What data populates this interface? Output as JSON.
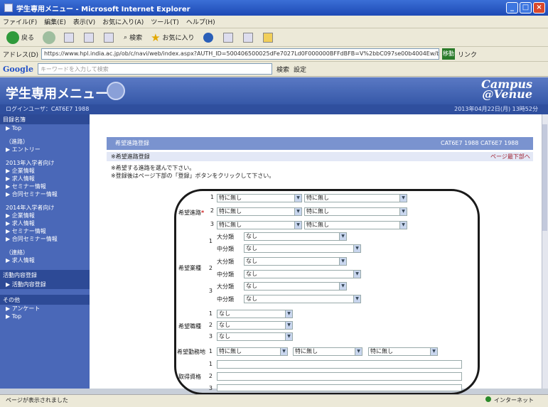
{
  "window": {
    "title": "学生専用メニュー - Microsoft Internet Explorer"
  },
  "menu": [
    "ファイル(F)",
    "編集(E)",
    "表示(V)",
    "お気に入り(A)",
    "ツール(T)",
    "ヘルプ(H)"
  ],
  "toolbar": {
    "back": "戻る",
    "search": "検索",
    "favorites": "お気に入り"
  },
  "address": {
    "label": "アドレス(D)",
    "url": "https://www.hpl.india.ac.jp/ob/c/navi/web/index.aspx?AUTH_ID=500406500025dFe7027Ld0F000000BFFdBFB=V%2bbC097se00b4004Ew/b4ad=W9Rar=3",
    "go": "移動",
    "links": "リンク"
  },
  "google": {
    "brand": "Google",
    "placeholder": "キーワードを入力して検索",
    "search_button": "検索",
    "settings": "設定"
  },
  "app": {
    "title": "学生専用メニュー",
    "brand_top": "Campus",
    "brand_bottom": "@Venue",
    "user": "ログインユーザ：CAT6E7 1988",
    "date": "2013年04月22日(月) 13時52分"
  },
  "sidebar": {
    "header1": "目録名簿",
    "items1": [
      "▶ Top"
    ],
    "items2": [
      "（進路）",
      "▶ エントリー"
    ],
    "group1_title": "2013年入学者向け",
    "group1": [
      "▶ 企業情報",
      "▶ 求人情報",
      "▶ セミナー情報",
      "▶ 合同セミナー情報"
    ],
    "group2_title": "2014年入学者向け",
    "group2": [
      "▶ 企業情報",
      "▶ 求人情報",
      "▶ セミナー情報",
      "▶ 合同セミナー情報"
    ],
    "group3_title": "（連絡）",
    "group3": [
      "▶ 求人情報"
    ],
    "header2": "活動内容登録",
    "active": "▶ 活動内容登録",
    "header3": "その他",
    "group4": [
      "▶ アンケート",
      "▶ Top"
    ]
  },
  "main": {
    "panel_title": "希望進路登録",
    "panel_user": "CAT6E7 1988 CAT6E7 1988",
    "section_title": "※希望進路登録",
    "section_link": "ページ最下部へ",
    "note1": "※希望する進路を選んで下さい。",
    "note2": "※登録後はページ下部の「登録」ボタンをクリックして下さい。",
    "labels": {
      "kibou_shinro": "希望進路",
      "kibou_gyoshu": "希望業種",
      "kibou_shokushu": "希望職種",
      "kibou_kinmuchi": "希望勤務地",
      "kibou_shikaku": "取得資格"
    },
    "req": "*",
    "nums": [
      "1",
      "2",
      "3"
    ],
    "big": "大分類",
    "mid": "中分類",
    "none_na": "特に無し",
    "none": "なし"
  },
  "status": {
    "left": "ページが表示されました",
    "right": "インターネット"
  }
}
